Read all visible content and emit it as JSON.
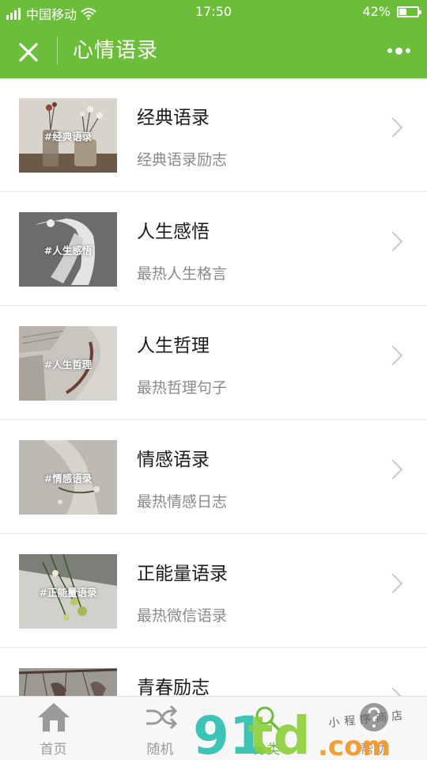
{
  "status_bar": {
    "carrier": "中国移动",
    "time": "17:50",
    "battery": "42%",
    "battery_level": 0.42
  },
  "navbar": {
    "title": "心情语录",
    "close_icon": "close-icon",
    "more_icon": "more-icon"
  },
  "items": [
    {
      "title": "经典语录",
      "subtitle": "经典语录励志",
      "tag": "#经典语录"
    },
    {
      "title": "人生感悟",
      "subtitle": "最热人生格言",
      "tag": "#人生感悟"
    },
    {
      "title": "人生哲理",
      "subtitle": "最热哲理句子",
      "tag": "#人生哲理"
    },
    {
      "title": "情感语录",
      "subtitle": "最热情感日志",
      "tag": "#情感语录"
    },
    {
      "title": "正能量语录",
      "subtitle": "最热微信语录",
      "tag": "#正能量语录"
    },
    {
      "title": "青春励志",
      "subtitle": "",
      "tag": ""
    }
  ],
  "tabbar": [
    {
      "label": "首页",
      "icon": "home-icon"
    },
    {
      "label": "随机",
      "icon": "shuffle-icon"
    },
    {
      "label": "分类",
      "icon": "search-icon",
      "active": true
    },
    {
      "label": "帮助",
      "icon": "help-icon"
    }
  ],
  "watermark": {
    "text_small": "小程序商店",
    "brand_number": "91",
    "brand_letters": "td",
    "brand_suffix": ".com"
  },
  "colors": {
    "accent": "#6abe3a",
    "watermark_teal": "#2bbfae",
    "watermark_orange": "#f39a2b"
  }
}
